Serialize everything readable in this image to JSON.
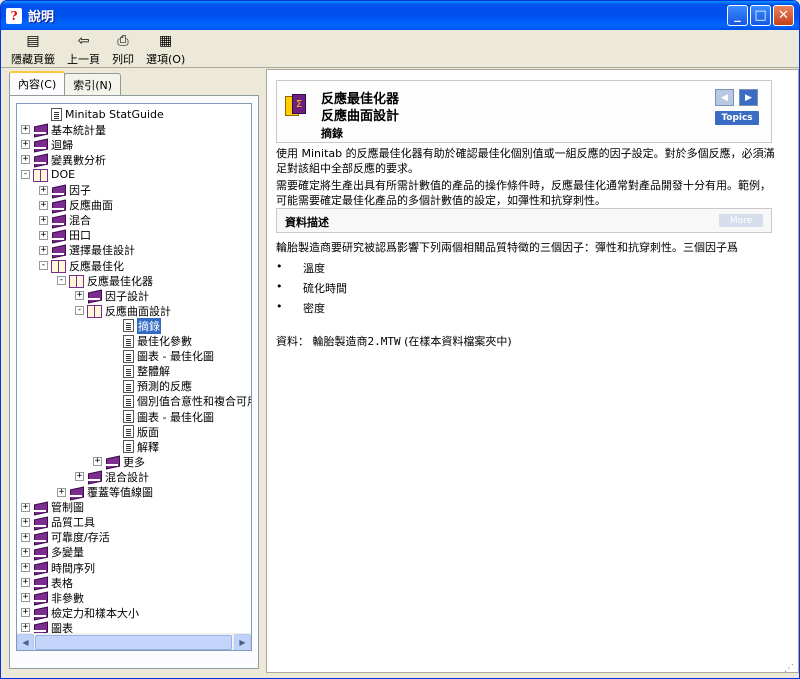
{
  "window": {
    "title": "說明",
    "app_icon": "?",
    "controls": {
      "minimize": "_",
      "maximize": "□",
      "close": "✕"
    }
  },
  "toolbar": {
    "items": [
      {
        "label": "隱藏頁籤",
        "icon": "hide-tabs-icon"
      },
      {
        "label": "上一頁",
        "icon": "back-arrow-icon"
      },
      {
        "label": "列印",
        "icon": "printer-icon"
      },
      {
        "label": "選項(O)",
        "icon": "options-icon"
      }
    ]
  },
  "tabs": [
    {
      "label": "內容(C)",
      "active": true
    },
    {
      "label": "索引(N)",
      "active": false
    }
  ],
  "tree": [
    {
      "label": "Minitab StatGuide",
      "type": "page",
      "level": 1,
      "expander": ""
    },
    {
      "label": "基本統計量",
      "type": "book-closed",
      "level": 0,
      "expander": "+"
    },
    {
      "label": "迴歸",
      "type": "book-closed",
      "level": 0,
      "expander": "+"
    },
    {
      "label": "變異數分析",
      "type": "book-closed",
      "level": 0,
      "expander": "+"
    },
    {
      "label": "DOE",
      "type": "book-open",
      "level": 0,
      "expander": "-"
    },
    {
      "label": "因子",
      "type": "book-closed",
      "level": 1,
      "expander": "+"
    },
    {
      "label": "反應曲面",
      "type": "book-closed",
      "level": 1,
      "expander": "+"
    },
    {
      "label": "混合",
      "type": "book-closed",
      "level": 1,
      "expander": "+"
    },
    {
      "label": "田口",
      "type": "book-closed",
      "level": 1,
      "expander": "+"
    },
    {
      "label": "選擇最佳設計",
      "type": "book-closed",
      "level": 1,
      "expander": "+"
    },
    {
      "label": "反應最佳化",
      "type": "book-open",
      "level": 1,
      "expander": "-"
    },
    {
      "label": "反應最佳化器",
      "type": "book-open",
      "level": 2,
      "expander": "-"
    },
    {
      "label": "因子設計",
      "type": "book-closed",
      "level": 3,
      "expander": "+"
    },
    {
      "label": "反應曲面設計",
      "type": "book-open",
      "level": 3,
      "expander": "-"
    },
    {
      "label": "摘錄",
      "type": "page",
      "level": 5,
      "expander": "",
      "selected": true
    },
    {
      "label": "最佳化參數",
      "type": "page",
      "level": 5,
      "expander": ""
    },
    {
      "label": "圖表 - 最佳化圖",
      "type": "page",
      "level": 5,
      "expander": ""
    },
    {
      "label": "整體解",
      "type": "page",
      "level": 5,
      "expander": ""
    },
    {
      "label": "預測的反應",
      "type": "page",
      "level": 5,
      "expander": ""
    },
    {
      "label": "個別值合意性和複合可用",
      "type": "page",
      "level": 5,
      "expander": ""
    },
    {
      "label": "圖表 - 最佳化圖",
      "type": "page",
      "level": 5,
      "expander": ""
    },
    {
      "label": "版面",
      "type": "page",
      "level": 5,
      "expander": ""
    },
    {
      "label": "解釋",
      "type": "page",
      "level": 5,
      "expander": ""
    },
    {
      "label": "更多",
      "type": "book-closed",
      "level": 4,
      "expander": "+"
    },
    {
      "label": "混合設計",
      "type": "book-closed",
      "level": 3,
      "expander": "+"
    },
    {
      "label": "覆蓋等值線圖",
      "type": "book-closed",
      "level": 2,
      "expander": "+"
    },
    {
      "label": "管制圖",
      "type": "book-closed",
      "level": 0,
      "expander": "+"
    },
    {
      "label": "品質工具",
      "type": "book-closed",
      "level": 0,
      "expander": "+"
    },
    {
      "label": "可靠度/存活",
      "type": "book-closed",
      "level": 0,
      "expander": "+"
    },
    {
      "label": "多變量",
      "type": "book-closed",
      "level": 0,
      "expander": "+"
    },
    {
      "label": "時間序列",
      "type": "book-closed",
      "level": 0,
      "expander": "+"
    },
    {
      "label": "表格",
      "type": "book-closed",
      "level": 0,
      "expander": "+"
    },
    {
      "label": "非參數",
      "type": "book-closed",
      "level": 0,
      "expander": "+"
    },
    {
      "label": "檢定力和樣本大小",
      "type": "book-closed",
      "level": 0,
      "expander": "+"
    },
    {
      "label": "圖表",
      "type": "book-closed",
      "level": 0,
      "expander": "+"
    }
  ],
  "content": {
    "title1": "反應最佳化器",
    "title2": "反應曲面設計",
    "subtitle": "摘錄",
    "topics_label": "Topics",
    "para1": "使用 Minitab 的反應最佳化器有助於確認最佳化個別值或一組反應的因子設定。對於多個反應，必須滿足對該組中全部反應的要求。",
    "para2": "需要確定將生產出具有所需計數值的產品的操作條件時，反應最佳化通常對產品開發十分有用。範例，可能需要確定最佳化產品的多個計數值的設定，如彈性和抗穿刺性。",
    "section_title": "資料描述",
    "more_label": "More",
    "para3": "輪胎製造商要研究被認爲影響下列兩個相關品質特徵的三個因子：彈性和抗穿刺性。三個因子爲",
    "bullets": [
      "溫度",
      "硫化時間",
      "密度"
    ],
    "data_label": "資料：",
    "data_file": "輪胎製造商2.MTW",
    "data_note": "(在樣本資料檔案夾中)"
  }
}
